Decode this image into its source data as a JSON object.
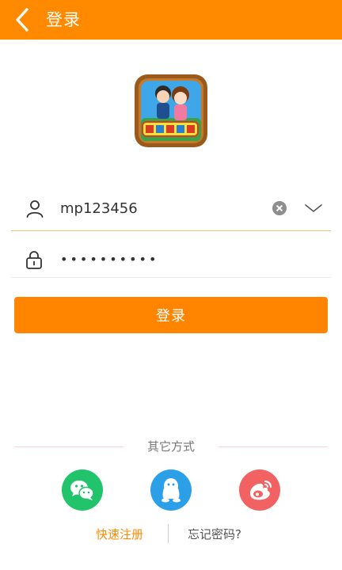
{
  "header": {
    "title": "登录"
  },
  "login_form": {
    "username_value": "mp123456",
    "password_masked": "••••••••••",
    "submit_label": "登录"
  },
  "other_methods": {
    "label": "其它方式",
    "providers": [
      "wechat",
      "qq",
      "weibo"
    ]
  },
  "footer": {
    "register_label": "快速注册",
    "forgot_label": "忘记密码?"
  },
  "colors": {
    "brand": "#ff8a00",
    "wechat": "#21c46a",
    "qq": "#2ba0e8",
    "weibo": "#f26262"
  }
}
